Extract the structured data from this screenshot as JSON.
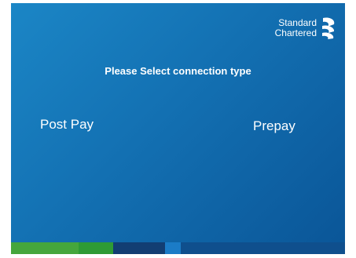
{
  "brand": {
    "line1": "Standard",
    "line2": "Chartered",
    "logo_icon": "standard-chartered-logo-icon"
  },
  "prompt": "Please Select connection type",
  "options": {
    "post_pay": "Post Pay",
    "prepay": "Prepay"
  },
  "colors": {
    "background_light": "#1b86c6",
    "background_dark": "#0a5597",
    "stripe_light_green": "#45a63c",
    "stripe_green": "#2e9b35",
    "stripe_navy": "#123e73",
    "stripe_blue": "#1b7cc7",
    "stripe_mid_blue": "#0f4f8d"
  }
}
